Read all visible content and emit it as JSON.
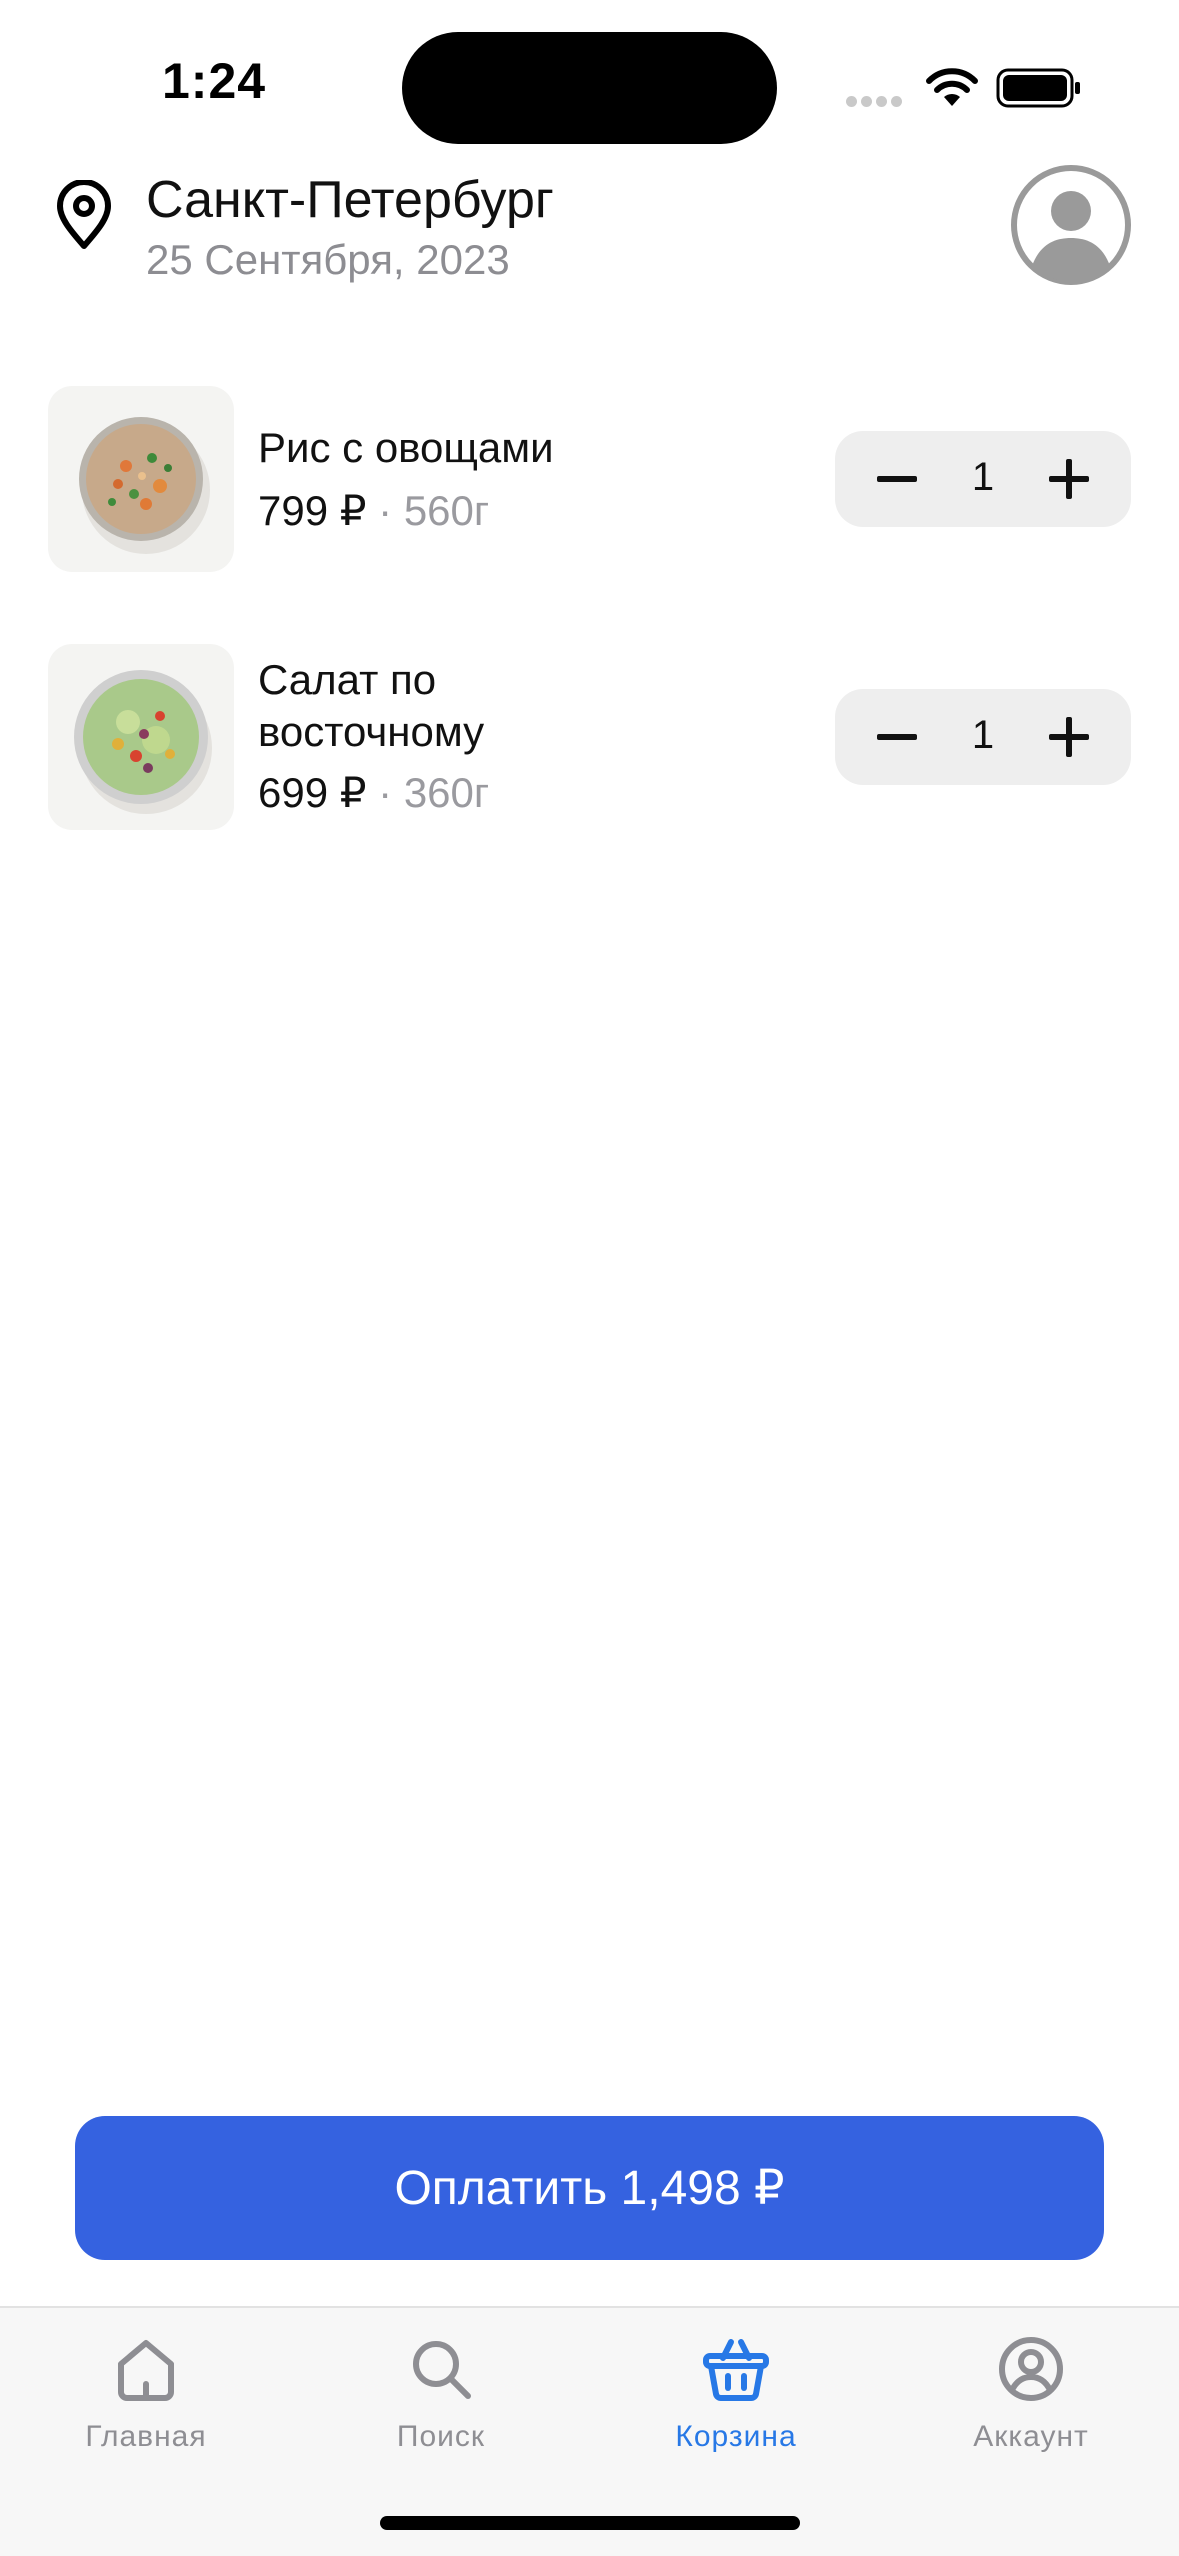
{
  "status_bar": {
    "time": "1:24"
  },
  "header": {
    "city": "Санкт-Петербург",
    "date": "25 Сентября, 2023"
  },
  "cart": {
    "items": [
      {
        "name": "Рис с овощами",
        "price": "799 ₽",
        "separator": "·",
        "weight": "560г",
        "quantity": "1"
      },
      {
        "name": "Салат по восточному",
        "price": "699 ₽",
        "separator": "·",
        "weight": "360г",
        "quantity": "1"
      }
    ]
  },
  "pay_button": {
    "label": "Оплатить 1,498 ₽"
  },
  "tab_bar": {
    "tabs": [
      {
        "label": "Главная",
        "icon": "home-icon",
        "active": false
      },
      {
        "label": "Поиск",
        "icon": "search-icon",
        "active": false
      },
      {
        "label": "Корзина",
        "icon": "basket-icon",
        "active": true
      },
      {
        "label": "Аккаунт",
        "icon": "account-icon",
        "active": false
      }
    ]
  },
  "colors": {
    "accent": "#3562e0",
    "active_tab": "#2778e6",
    "inactive_tab": "#8e8e93",
    "secondary_text": "#8d8d92"
  }
}
